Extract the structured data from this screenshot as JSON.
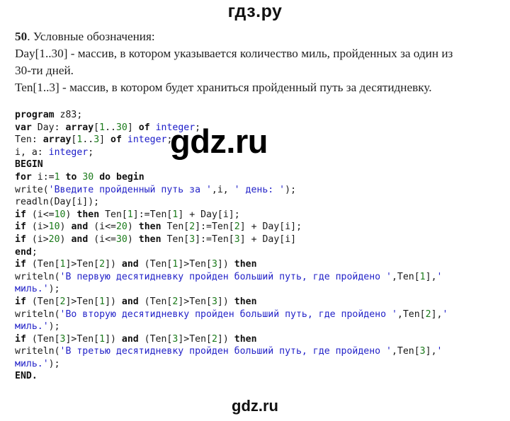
{
  "header": {
    "site_title": "гдз.ру"
  },
  "watermark": {
    "text": "gdz.ru"
  },
  "footer": {
    "site_title": "gdz.ru"
  },
  "description": {
    "task_number": "50",
    "intro": ". Условные обозначения:",
    "day_line_1": "Day[1..30] - массив, в котором указывается количество миль, пройденных за один из",
    "day_line_2": "30-ти дней.",
    "ten_line": "Ten[1..3] - массив, в котором будет храниться пройденный путь за десятидневку."
  },
  "code": {
    "lines": [
      [
        {
          "t": "kw",
          "v": "program"
        },
        {
          "t": "p",
          "v": " z83;"
        }
      ],
      [
        {
          "t": "kw",
          "v": "var"
        },
        {
          "t": "p",
          "v": " Day: "
        },
        {
          "t": "kw",
          "v": "array"
        },
        {
          "t": "p",
          "v": "["
        },
        {
          "t": "n",
          "v": "1"
        },
        {
          "t": "p",
          "v": ".."
        },
        {
          "t": "n",
          "v": "30"
        },
        {
          "t": "p",
          "v": "] "
        },
        {
          "t": "kw",
          "v": "of"
        },
        {
          "t": "p",
          "v": " "
        },
        {
          "t": "ty",
          "v": "integer"
        },
        {
          "t": "p",
          "v": ";"
        }
      ],
      [
        {
          "t": "p",
          "v": "Ten: "
        },
        {
          "t": "kw",
          "v": "array"
        },
        {
          "t": "p",
          "v": "["
        },
        {
          "t": "n",
          "v": "1"
        },
        {
          "t": "p",
          "v": ".."
        },
        {
          "t": "n",
          "v": "3"
        },
        {
          "t": "p",
          "v": "] "
        },
        {
          "t": "kw",
          "v": "of"
        },
        {
          "t": "p",
          "v": " "
        },
        {
          "t": "ty",
          "v": "integer"
        },
        {
          "t": "p",
          "v": ";"
        }
      ],
      [
        {
          "t": "p",
          "v": "i, a: "
        },
        {
          "t": "ty",
          "v": "integer"
        },
        {
          "t": "p",
          "v": ";"
        }
      ],
      [
        {
          "t": "kw",
          "v": "BEGIN"
        }
      ],
      [
        {
          "t": "kw",
          "v": "for"
        },
        {
          "t": "p",
          "v": " i:="
        },
        {
          "t": "n",
          "v": "1"
        },
        {
          "t": "p",
          "v": " "
        },
        {
          "t": "kw",
          "v": "to"
        },
        {
          "t": "p",
          "v": " "
        },
        {
          "t": "n",
          "v": "30"
        },
        {
          "t": "p",
          "v": " "
        },
        {
          "t": "kw",
          "v": "do"
        },
        {
          "t": "p",
          "v": " "
        },
        {
          "t": "kw",
          "v": "begin"
        }
      ],
      [
        {
          "t": "p",
          "v": "write("
        },
        {
          "t": "str",
          "v": "'Введите пройденный путь за '"
        },
        {
          "t": "p",
          "v": ",i, "
        },
        {
          "t": "str",
          "v": "' день: '"
        },
        {
          "t": "p",
          "v": ");"
        }
      ],
      [
        {
          "t": "p",
          "v": "readln(Day[i]);"
        }
      ],
      [
        {
          "t": "kw",
          "v": "if"
        },
        {
          "t": "p",
          "v": " (i<="
        },
        {
          "t": "n",
          "v": "10"
        },
        {
          "t": "p",
          "v": ") "
        },
        {
          "t": "kw",
          "v": "then"
        },
        {
          "t": "p",
          "v": " Ten["
        },
        {
          "t": "n",
          "v": "1"
        },
        {
          "t": "p",
          "v": "]:=Ten["
        },
        {
          "t": "n",
          "v": "1"
        },
        {
          "t": "p",
          "v": "] + Day[i];"
        }
      ],
      [
        {
          "t": "kw",
          "v": "if"
        },
        {
          "t": "p",
          "v": " (i>"
        },
        {
          "t": "n",
          "v": "10"
        },
        {
          "t": "p",
          "v": ") "
        },
        {
          "t": "kw",
          "v": "and"
        },
        {
          "t": "p",
          "v": " (i<="
        },
        {
          "t": "n",
          "v": "20"
        },
        {
          "t": "p",
          "v": ") "
        },
        {
          "t": "kw",
          "v": "then"
        },
        {
          "t": "p",
          "v": " Ten["
        },
        {
          "t": "n",
          "v": "2"
        },
        {
          "t": "p",
          "v": "]:=Ten["
        },
        {
          "t": "n",
          "v": "2"
        },
        {
          "t": "p",
          "v": "] + Day[i];"
        }
      ],
      [
        {
          "t": "kw",
          "v": "if"
        },
        {
          "t": "p",
          "v": " (i>"
        },
        {
          "t": "n",
          "v": "20"
        },
        {
          "t": "p",
          "v": ") "
        },
        {
          "t": "kw",
          "v": "and"
        },
        {
          "t": "p",
          "v": " (i<="
        },
        {
          "t": "n",
          "v": "30"
        },
        {
          "t": "p",
          "v": ") "
        },
        {
          "t": "kw",
          "v": "then"
        },
        {
          "t": "p",
          "v": " Ten["
        },
        {
          "t": "n",
          "v": "3"
        },
        {
          "t": "p",
          "v": "]:=Ten["
        },
        {
          "t": "n",
          "v": "3"
        },
        {
          "t": "p",
          "v": "] + Day[i]"
        }
      ],
      [
        {
          "t": "kw",
          "v": "end"
        },
        {
          "t": "p",
          "v": ";"
        }
      ],
      [
        {
          "t": "kw",
          "v": "if"
        },
        {
          "t": "p",
          "v": " (Ten["
        },
        {
          "t": "n",
          "v": "1"
        },
        {
          "t": "p",
          "v": "]>Ten["
        },
        {
          "t": "n",
          "v": "2"
        },
        {
          "t": "p",
          "v": "]) "
        },
        {
          "t": "kw",
          "v": "and"
        },
        {
          "t": "p",
          "v": " (Ten["
        },
        {
          "t": "n",
          "v": "1"
        },
        {
          "t": "p",
          "v": "]>Ten["
        },
        {
          "t": "n",
          "v": "3"
        },
        {
          "t": "p",
          "v": "]) "
        },
        {
          "t": "kw",
          "v": "then"
        }
      ],
      [
        {
          "t": "p",
          "v": "writeln("
        },
        {
          "t": "str",
          "v": "'В первую десятидневку пройден больший путь, где пройдено '"
        },
        {
          "t": "p",
          "v": ",Ten["
        },
        {
          "t": "n",
          "v": "1"
        },
        {
          "t": "p",
          "v": "],"
        },
        {
          "t": "str",
          "v": "'"
        }
      ],
      [
        {
          "t": "str",
          "v": "миль.'"
        },
        {
          "t": "p",
          "v": ");"
        }
      ],
      [
        {
          "t": "kw",
          "v": "if"
        },
        {
          "t": "p",
          "v": " (Ten["
        },
        {
          "t": "n",
          "v": "2"
        },
        {
          "t": "p",
          "v": "]>Ten["
        },
        {
          "t": "n",
          "v": "1"
        },
        {
          "t": "p",
          "v": "]) "
        },
        {
          "t": "kw",
          "v": "and"
        },
        {
          "t": "p",
          "v": " (Ten["
        },
        {
          "t": "n",
          "v": "2"
        },
        {
          "t": "p",
          "v": "]>Ten["
        },
        {
          "t": "n",
          "v": "3"
        },
        {
          "t": "p",
          "v": "]) "
        },
        {
          "t": "kw",
          "v": "then"
        }
      ],
      [
        {
          "t": "p",
          "v": "writeln("
        },
        {
          "t": "str",
          "v": "'Во вторую десятидневку пройден больший путь, где пройдено '"
        },
        {
          "t": "p",
          "v": ",Ten["
        },
        {
          "t": "n",
          "v": "2"
        },
        {
          "t": "p",
          "v": "],"
        },
        {
          "t": "str",
          "v": "'"
        }
      ],
      [
        {
          "t": "str",
          "v": "миль.'"
        },
        {
          "t": "p",
          "v": ");"
        }
      ],
      [
        {
          "t": "kw",
          "v": "if"
        },
        {
          "t": "p",
          "v": " (Ten["
        },
        {
          "t": "n",
          "v": "3"
        },
        {
          "t": "p",
          "v": "]>Ten["
        },
        {
          "t": "n",
          "v": "1"
        },
        {
          "t": "p",
          "v": "]) "
        },
        {
          "t": "kw",
          "v": "and"
        },
        {
          "t": "p",
          "v": " (Ten["
        },
        {
          "t": "n",
          "v": "3"
        },
        {
          "t": "p",
          "v": "]>Ten["
        },
        {
          "t": "n",
          "v": "2"
        },
        {
          "t": "p",
          "v": "]) "
        },
        {
          "t": "kw",
          "v": "then"
        }
      ],
      [
        {
          "t": "p",
          "v": "writeln("
        },
        {
          "t": "str",
          "v": "'В третью десятидневку пройден больший путь, где пройдено '"
        },
        {
          "t": "p",
          "v": ",Ten["
        },
        {
          "t": "n",
          "v": "3"
        },
        {
          "t": "p",
          "v": "],"
        },
        {
          "t": "str",
          "v": "'"
        }
      ],
      [
        {
          "t": "str",
          "v": "миль.'"
        },
        {
          "t": "p",
          "v": ");"
        }
      ],
      [
        {
          "t": "kw",
          "v": "END."
        }
      ]
    ]
  },
  "colors": {
    "keyword": "#111111",
    "type": "#1a1ac8",
    "string": "#2323c8",
    "number": "#1a7a1a",
    "plain": "#1a1a1a"
  }
}
